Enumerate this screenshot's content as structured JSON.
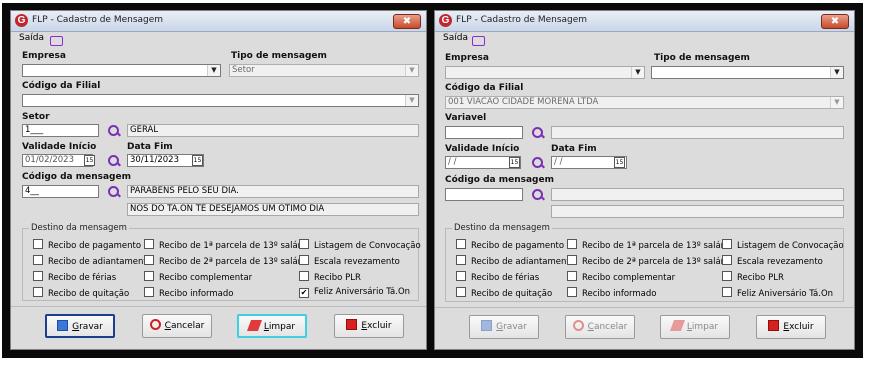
{
  "left": {
    "title": "FLP - Cadastro de Mensagem",
    "menu_saida": "Saída",
    "labels": {
      "empresa": "Empresa",
      "tipo": "Tipo de mensagem",
      "filial": "Código da Filial",
      "setor": "Setor",
      "validade": "Validade Início",
      "datafim": "Data Fim",
      "codigo": "Código da mensagem"
    },
    "values": {
      "tipo": "Setor",
      "setor_code": "1___",
      "setor_desc": "GERAL",
      "validade": "01/02/2023",
      "datafim": "30/11/2023",
      "codigo": "4__",
      "msg1": "PARABÉNS PELO SEU DIA.",
      "msg2": "NÓS DO TÁ.ON TE DESEJAMOS UM OTIMO DIA"
    },
    "destino_title": "Destino da mensagem",
    "checkboxes": [
      {
        "label": "Recibo de pagamento",
        "checked": false
      },
      {
        "label": "Recibo de adiantamento",
        "checked": false
      },
      {
        "label": "Recibo de férias",
        "checked": false
      },
      {
        "label": "Recibo de quitação",
        "checked": false
      },
      {
        "label": "Recibo de 1ª parcela de 13º salário",
        "checked": false
      },
      {
        "label": "Recibo de 2ª parcela de 13º salário",
        "checked": false
      },
      {
        "label": "Recibo complementar",
        "checked": false
      },
      {
        "label": "Recibo informado",
        "checked": false
      },
      {
        "label": "Listagem de Convocação",
        "checked": false
      },
      {
        "label": "Escala revezamento",
        "checked": false
      },
      {
        "label": "Recibo PLR",
        "checked": false
      },
      {
        "label": "Feliz Aniversário Tá.On",
        "checked": true
      }
    ],
    "buttons": {
      "gravar_u": "G",
      "gravar_rest": "ravar",
      "cancelar_u": "C",
      "cancelar_rest": "ancelar",
      "limpar_u": "L",
      "limpar_rest": "impar",
      "excluir_u": "E",
      "excluir_rest": "xcluir"
    }
  },
  "right": {
    "title": "FLP - Cadastro de Mensagem",
    "menu_saida": "Saída",
    "labels": {
      "empresa": "Empresa",
      "tipo": "Tipo de mensagem",
      "filial": "Código da Filial",
      "variavel": "Variavel",
      "validade": "Validade Início",
      "datafim": "Data Fim",
      "codigo": "Código da mensagem"
    },
    "values": {
      "filial": "001 VIACAO CIDADE MORENA LTDA",
      "validade": "/ /",
      "datafim": "/ /"
    },
    "destino_title": "Destino da mensagem",
    "checkboxes": [
      {
        "label": "Recibo de pagamento",
        "checked": false
      },
      {
        "label": "Recibo de adiantamento",
        "checked": false
      },
      {
        "label": "Recibo de férias",
        "checked": false
      },
      {
        "label": "Recibo de quitação",
        "checked": false
      },
      {
        "label": "Recibo de 1ª parcela de 13º salário",
        "checked": false
      },
      {
        "label": "Recibo de 2ª parcela de 13º salário",
        "checked": false
      },
      {
        "label": "Recibo complementar",
        "checked": false
      },
      {
        "label": "Recibo informado",
        "checked": false
      },
      {
        "label": "Listagem de Convocação",
        "checked": false
      },
      {
        "label": "Escala revezamento",
        "checked": false
      },
      {
        "label": "Recibo PLR",
        "checked": false
      },
      {
        "label": "Feliz Aniversário Tá.On",
        "checked": false
      }
    ],
    "buttons": {
      "gravar_u": "G",
      "gravar_rest": "ravar",
      "cancelar_u": "C",
      "cancelar_rest": "ancelar",
      "limpar_u": "L",
      "limpar_rest": "impar",
      "excluir_u": "E",
      "excluir_rest": "xcluir"
    }
  },
  "icons": {
    "logo": "G",
    "close": "✖",
    "dropdown": "▼",
    "calendar": "15",
    "checkmark": "✔"
  }
}
